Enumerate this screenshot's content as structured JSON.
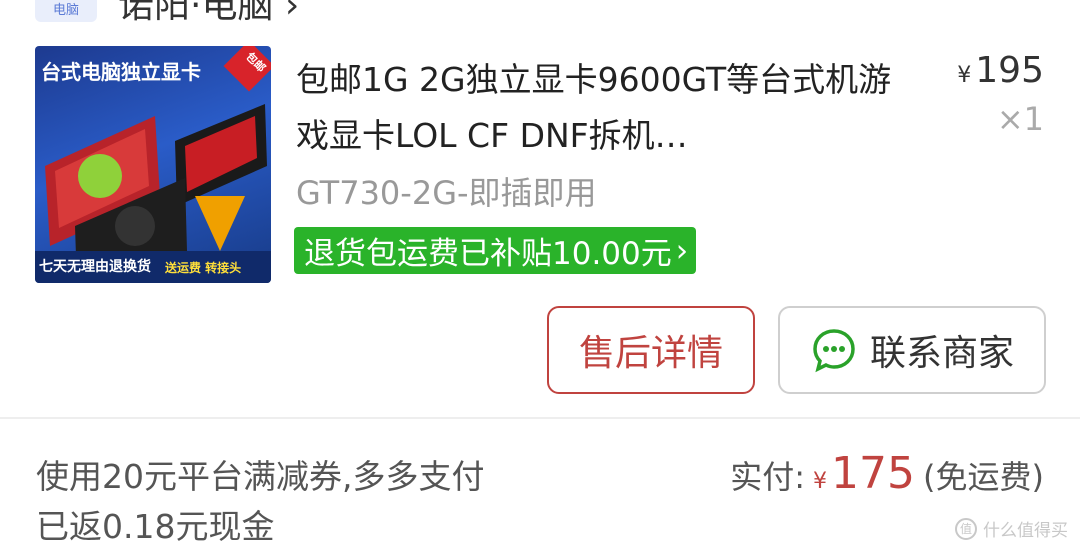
{
  "shop": {
    "icon_text": "电脑",
    "name": "诺阳·电脑",
    "chevron": "›"
  },
  "thumbnail": {
    "title": "台式电脑独立显卡",
    "badge": "包邮",
    "bottom_left": "七天无理由退换货",
    "bottom_right": "送运费 转接头"
  },
  "product": {
    "title": "包邮1G 2G独立显卡9600GT等台式机游戏显卡LOL CF DNF拆机…",
    "spec": "GT730-2G-即插即用",
    "refund_tag": "退货包运费已补贴10.00元",
    "refund_chevron": "›",
    "price_symbol": "¥",
    "price": "195",
    "quantity": "×1"
  },
  "actions": {
    "after_sales": "售后详情",
    "contact": "联系商家"
  },
  "footer": {
    "promo": "使用20元平台满减券,多多支付已返0.18元现金",
    "paid_label": "实付:",
    "paid_symbol": "¥",
    "paid_amount": "175",
    "shipping_note": "(免运费)"
  },
  "watermark": {
    "icon": "值",
    "text": "什么值得买"
  },
  "colors": {
    "accent_red": "#c0433f",
    "refund_green": "#2ab32a",
    "chat_green": "#2aa22a"
  }
}
